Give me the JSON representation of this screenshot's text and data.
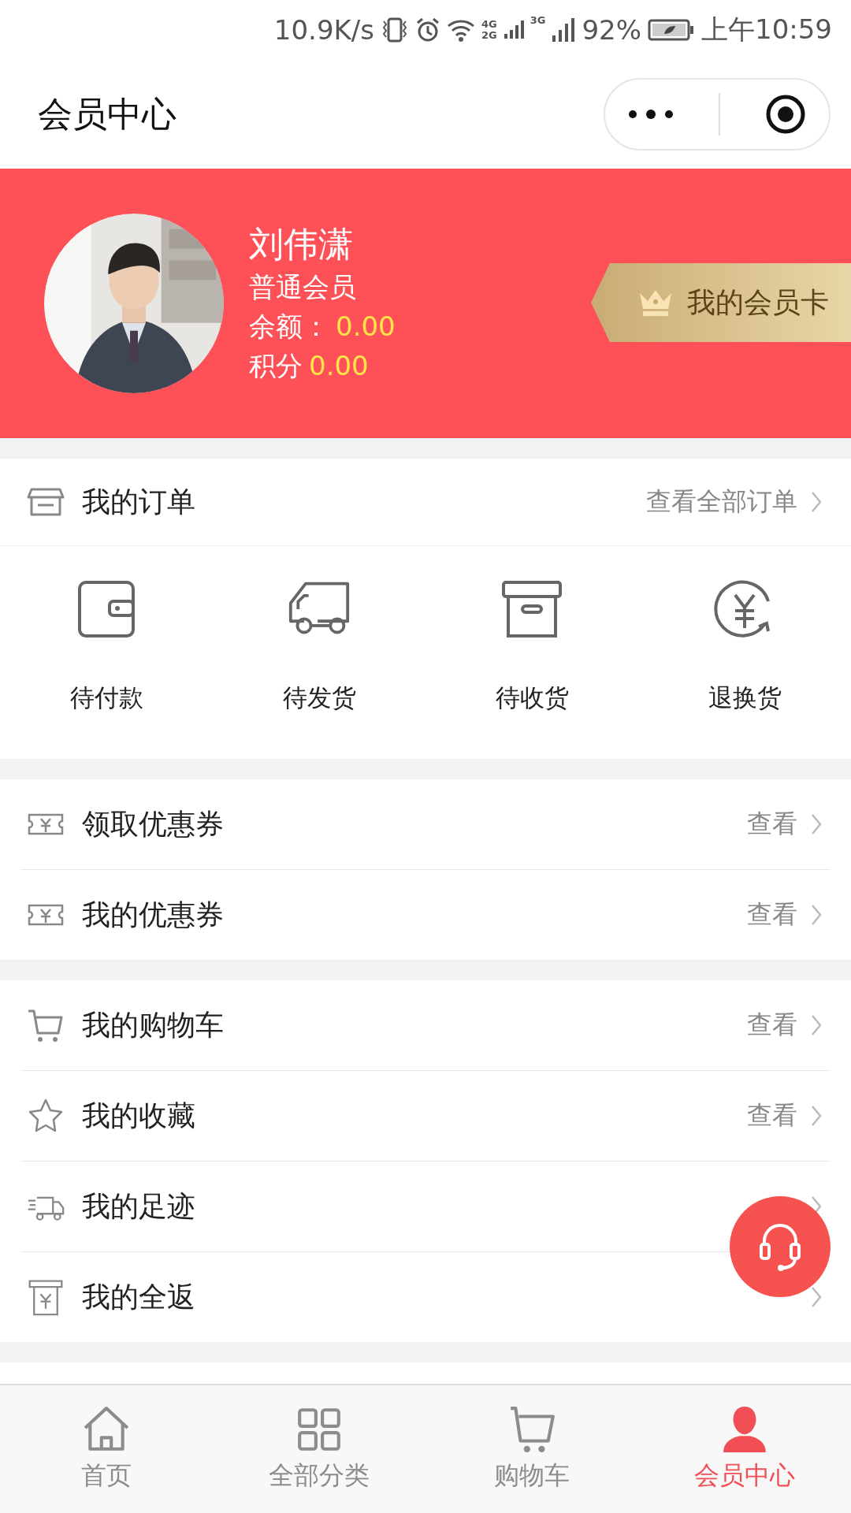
{
  "status_bar": {
    "speed": "10.9K/s",
    "network_a": "4G",
    "network_b": "2G",
    "network_c": "3G",
    "battery": "92%",
    "time": "上午10:59"
  },
  "header": {
    "title": "会员中心"
  },
  "profile": {
    "name": "刘伟潇",
    "level": "普通会员",
    "balance_label": "余额：",
    "balance": "0.00",
    "points_label": "积分",
    "points": "0.00",
    "card_button": "我的会员卡"
  },
  "orders": {
    "title": "我的订单",
    "view_all": "查看全部订单",
    "statuses": [
      {
        "label": "待付款",
        "kind": "wallet"
      },
      {
        "label": "待发货",
        "kind": "truck"
      },
      {
        "label": "待收货",
        "kind": "box"
      },
      {
        "label": "退换货",
        "kind": "refund"
      }
    ]
  },
  "sections": [
    {
      "items": [
        {
          "label": "领取优惠券",
          "action": "查看",
          "kind": "coupon"
        },
        {
          "label": "我的优惠券",
          "action": "查看",
          "kind": "coupon"
        }
      ]
    },
    {
      "items": [
        {
          "label": "我的购物车",
          "action": "查看",
          "kind": "cart"
        },
        {
          "label": "我的收藏",
          "action": "查看",
          "kind": "star"
        },
        {
          "label": "我的足迹",
          "kind": "delivery"
        },
        {
          "label": "我的全返",
          "kind": "receipt"
        }
      ]
    }
  ],
  "tabs": [
    {
      "label": "首页",
      "kind": "home",
      "selected": false
    },
    {
      "label": "全部分类",
      "kind": "grid",
      "selected": false
    },
    {
      "label": "购物车",
      "kind": "cart",
      "selected": false
    },
    {
      "label": "会员中心",
      "kind": "user",
      "selected": true
    }
  ]
}
